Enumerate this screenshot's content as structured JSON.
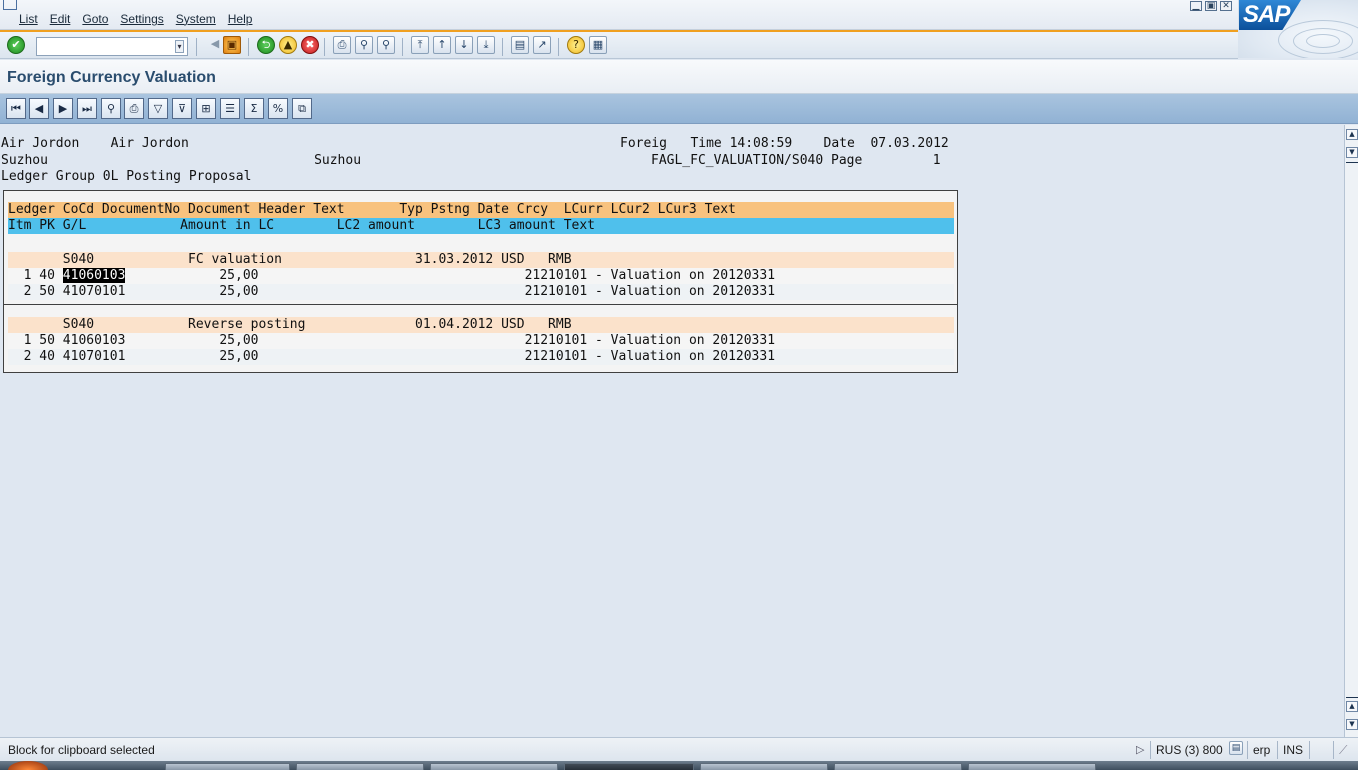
{
  "menu": [
    "List",
    "Edit",
    "Goto",
    "Settings",
    "System",
    "Help"
  ],
  "window_controls": [
    "▁",
    "▣",
    "✕"
  ],
  "sap_logo": "SAP",
  "command_field": {
    "value": "",
    "dropdown": "▾"
  },
  "std_toolbar": [
    {
      "name": "enter-icon",
      "glyph": "✔",
      "style": "green round"
    },
    {
      "name": "back-arrow-icon",
      "glyph": "◀",
      "style": "plain"
    },
    {
      "name": "save-icon",
      "glyph": "▣",
      "style": "orange"
    },
    {
      "name": "back-icon",
      "glyph": "⮌",
      "style": "green round"
    },
    {
      "name": "exit-icon",
      "glyph": "▲",
      "style": "yellow round"
    },
    {
      "name": "cancel-icon",
      "glyph": "✖",
      "style": "red round"
    },
    {
      "name": "print-icon",
      "glyph": "⎙",
      "style": "plain"
    },
    {
      "name": "find-icon",
      "glyph": "⚲",
      "style": "plain"
    },
    {
      "name": "find-next-icon",
      "glyph": "⚲",
      "style": "plain"
    },
    {
      "name": "first-page-icon",
      "glyph": "⤒",
      "style": "plain"
    },
    {
      "name": "previous-page-icon",
      "glyph": "↑",
      "style": "plain"
    },
    {
      "name": "next-page-icon",
      "glyph": "↓",
      "style": "plain"
    },
    {
      "name": "last-page-icon",
      "glyph": "⤓",
      "style": "plain"
    },
    {
      "name": "new-session-icon",
      "glyph": "▤",
      "style": "plain"
    },
    {
      "name": "shortcut-icon",
      "glyph": "↗",
      "style": "plain"
    },
    {
      "name": "help-icon",
      "glyph": "?",
      "style": "yellow round"
    },
    {
      "name": "layout-menu-icon",
      "glyph": "▦",
      "style": "plain"
    }
  ],
  "title": "Foreign Currency Valuation",
  "app_toolbar": [
    {
      "name": "first-icon",
      "glyph": "⏮"
    },
    {
      "name": "previous-icon",
      "glyph": "◀"
    },
    {
      "name": "next-icon",
      "glyph": "▶"
    },
    {
      "name": "last-icon",
      "glyph": "⏭"
    },
    {
      "name": "details-icon",
      "glyph": "⚲"
    },
    {
      "name": "print-preview-icon",
      "glyph": "⎙"
    },
    {
      "name": "filter-icon",
      "glyph": "▽"
    },
    {
      "name": "set-filter-icon",
      "glyph": "⊽"
    },
    {
      "name": "export-icon",
      "glyph": "⊞"
    },
    {
      "name": "change-layout-icon",
      "glyph": "☰"
    },
    {
      "name": "sum-icon",
      "glyph": "Σ"
    },
    {
      "name": "subtotals-icon",
      "glyph": "%"
    },
    {
      "name": "abc-analysis-icon",
      "glyph": "⧉"
    }
  ],
  "report_header": {
    "line1_left": "Air Jordon    Air Jordon",
    "line1_right": "Foreig   Time 14:08:59    Date  07.03.2012",
    "line2_left": "Suzhou                                  Suzhou",
    "line2_right": "FAGL_FC_VALUATION/S040 Page         1",
    "line3": "Ledger Group 0L Posting Proposal"
  },
  "table": {
    "header1": "Ledger CoCd DocumentNo Document Header Text       Typ Pstng Date Crcy  LCurr LCur2 LCur3 Text",
    "header2": "Itm PK G/L            Amount in LC        LC2 amount        LC3 amount Text",
    "groups": [
      {
        "header": "       S040            FC valuation                 31.03.2012 USD   RMB",
        "items": [
          {
            "pre": "  1 40 ",
            "gl": "41060103",
            "rest": "            25,00                                  21210101 - Valuation on 20120331",
            "selected": true
          },
          {
            "pre": "  2 50 ",
            "gl": "41070101",
            "rest": "            25,00                                  21210101 - Valuation on 20120331",
            "selected": false
          }
        ]
      },
      {
        "header": "       S040            Reverse posting              01.04.2012 USD   RMB",
        "items": [
          {
            "pre": "  1 50 ",
            "gl": "41060103",
            "rest": "            25,00                                  21210101 - Valuation on 20120331",
            "selected": false
          },
          {
            "pre": "  2 40 ",
            "gl": "41070101",
            "rest": "            25,00                                  21210101 - Valuation on 20120331",
            "selected": false
          }
        ]
      }
    ]
  },
  "scrollbar": {
    "up": "▲",
    "down": "▼"
  },
  "status": {
    "message": "Block for clipboard selected",
    "arrow": "▷",
    "system": "RUS (3) 800",
    "server": "erp",
    "mode": "INS"
  }
}
